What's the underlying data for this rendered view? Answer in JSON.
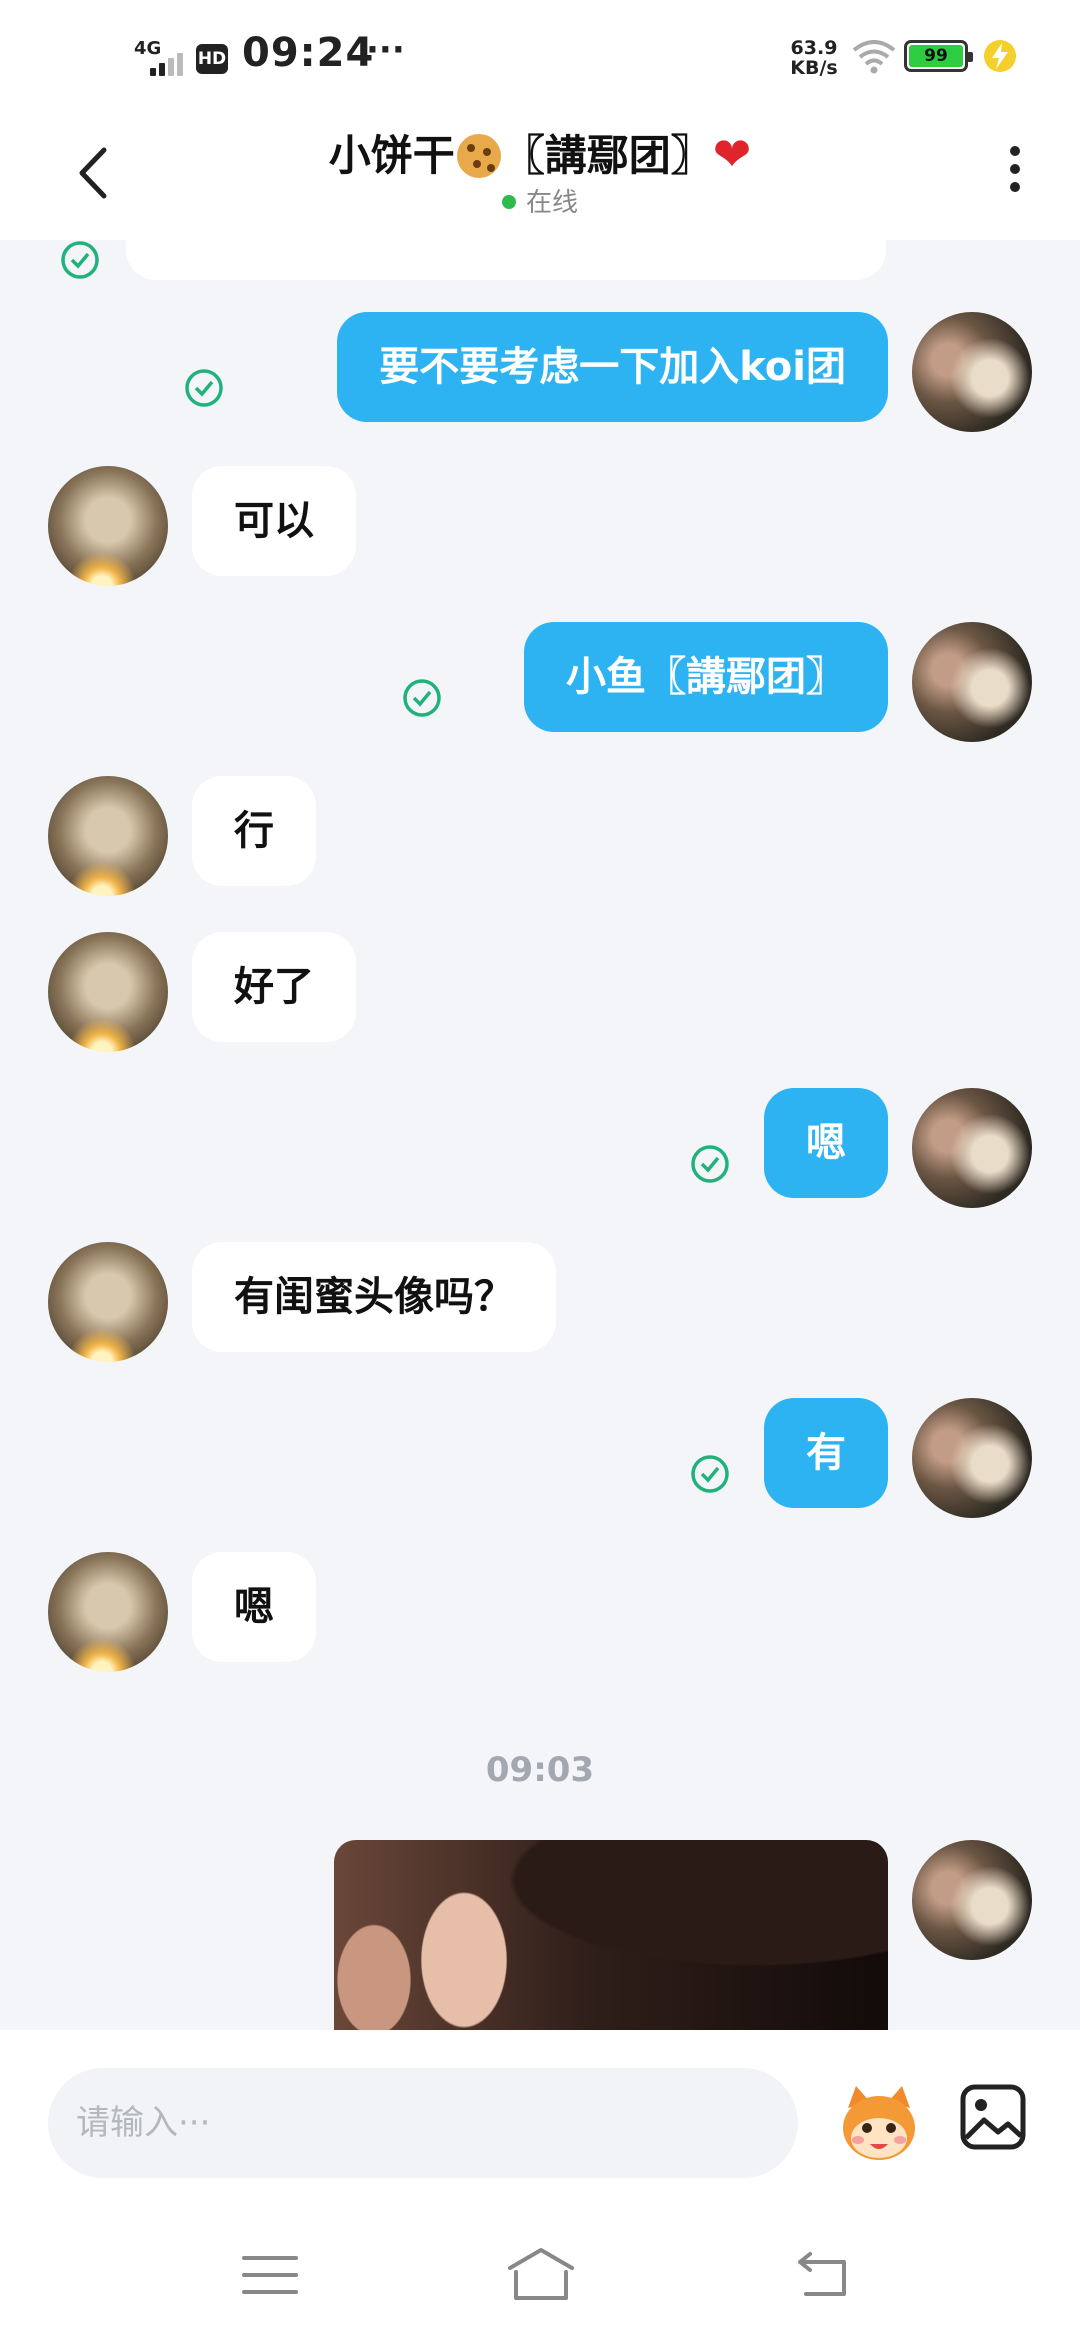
{
  "status_bar": {
    "network": "4G",
    "hd": "HD",
    "time": "09:24",
    "dots": "···",
    "speed_value": "63.9",
    "speed_unit": "KB/s",
    "battery": "99",
    "icons": [
      "signal-icon",
      "wifi-icon",
      "battery-icon",
      "charging-icon"
    ]
  },
  "header": {
    "title_prefix": "小饼干",
    "title_suffix": "〖講鄢团〗",
    "title_emoji_1": "cookie-emoji",
    "title_emoji_2": "❤",
    "status": "在线"
  },
  "messages": [
    {
      "side": "out",
      "text": "要不要考虑一下加入koi团",
      "read": true
    },
    {
      "side": "in",
      "text": "可以"
    },
    {
      "side": "out",
      "text": "小鱼〖講鄢团〗",
      "read": true
    },
    {
      "side": "in",
      "text": "行"
    },
    {
      "side": "in",
      "text": "好了"
    },
    {
      "side": "out",
      "text": "嗯",
      "read": true
    },
    {
      "side": "in",
      "text": "有闺蜜头像吗？"
    },
    {
      "side": "out",
      "text": "有",
      "read": true
    },
    {
      "side": "in",
      "text": "嗯"
    }
  ],
  "time_separator": "09:03",
  "input": {
    "placeholder": "请输入···"
  },
  "colors": {
    "outgoing_bubble": "#2eb3f2",
    "incoming_bubble": "#ffffff",
    "background": "#f3f5f9",
    "read_check": "#20b27a"
  }
}
